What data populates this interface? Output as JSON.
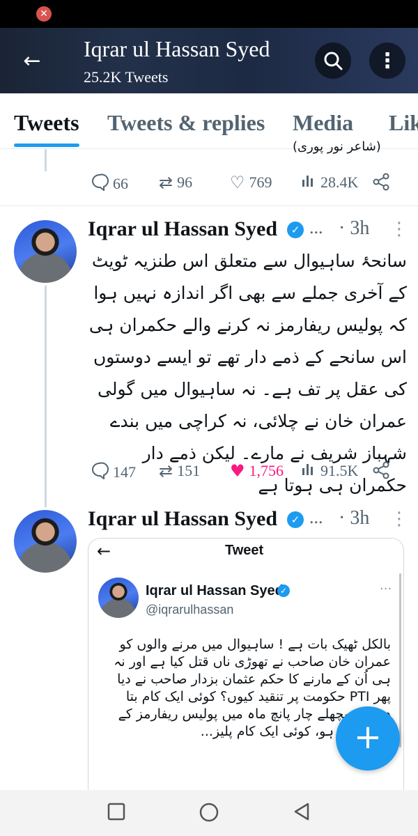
{
  "status_bar": {
    "app_icon": "app-notification-icon"
  },
  "header": {
    "title": "Iqrar ul Hassan Syed",
    "subtitle": "25.2K Tweets",
    "back_icon": "←",
    "search_icon": "⚲",
    "more_icon": "⋮"
  },
  "tabs": [
    {
      "label": "Tweets"
    },
    {
      "label": "Tweets & replies"
    },
    {
      "label": "Media"
    },
    {
      "label": "Lik"
    }
  ],
  "tweet0": {
    "fragment": "(شاعر نور پوری)",
    "replies": "66",
    "retweets": "96",
    "likes": "769",
    "views": "28.4K"
  },
  "tweet1": {
    "name": "Iqrar ul Hassan Syed",
    "ellipsis": "...",
    "time": "· 3h",
    "text": "سانحۂ ساہیوال سے متعلق اس طنزیہ ٹویٹ کے آخری جملے سے بھی اگر اندازہ نہیں ہوا کہ پولیس ریفارمز نہ کرنے والے حکمران ہی اس سانحے کے ذمے دار تھے تو ایسے دوستوں کی عقل پر تف ہے۔ نہ ساہیوال میں گولی عمران خان نے چلائی، نہ کراچی میں بندے شہباز شریف نے مارے۔ لیکن ذمے دار حکمران ہی ہوتا ہے",
    "replies": "147",
    "retweets": "151",
    "likes": "1,756",
    "views": "91.5K",
    "like_color": "#f91880"
  },
  "tweet2": {
    "name": "Iqrar ul Hassan Syed",
    "ellipsis": "...",
    "time": "· 3h",
    "embed": {
      "title": "Tweet",
      "name": "Iqrar ul Hassan Syed",
      "handle": "@iqrarulhassan",
      "text": "بالکل ٹھیک بات ہے ! ساہیوال میں مرنے والوں کو عمران خان صاحب نے تھوڑی ناں قتل کیا ہے اور نہ ہی اُن کے مارنے کا حکم عثمان بزدار صاحب نے دیا پھر PTI حکومت پر تنقید کیوں؟ کوئی ایک کام بتا دیں جو پچھلے چار پانچ ماہ میں پولیس ریفارمز کے لئے کیا گیا ہو، کوئی ایک کام پلیز..."
    }
  },
  "fab": {
    "label": "+"
  },
  "navbar": {
    "recents": "□",
    "home": "○",
    "back": "◁"
  },
  "colors": {
    "accent": "#1d9bf0",
    "like": "#f91880",
    "text": "#0f1419",
    "muted": "#536471"
  }
}
